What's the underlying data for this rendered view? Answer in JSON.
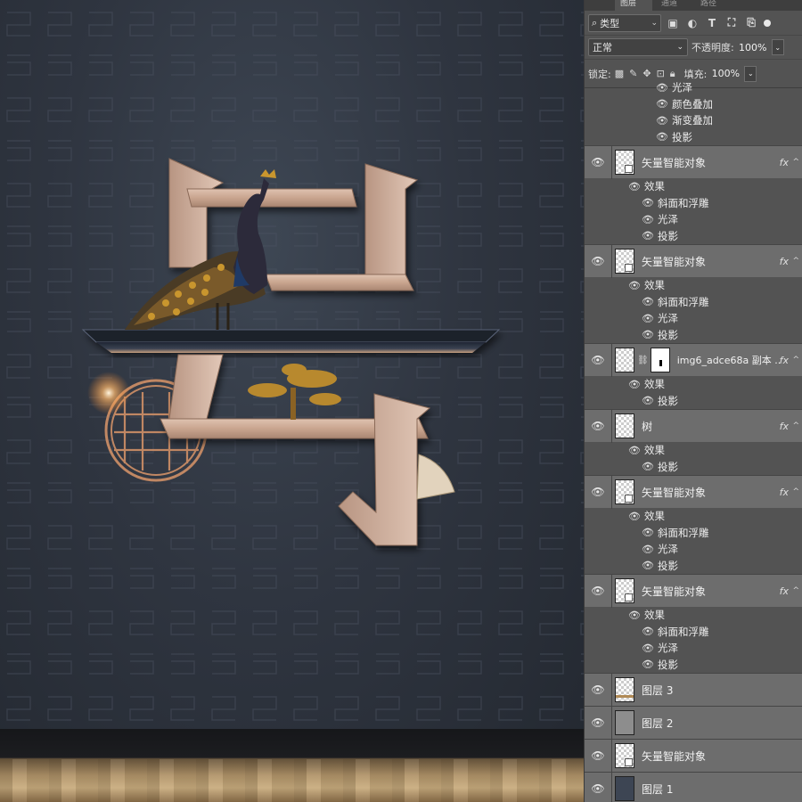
{
  "panel": {
    "tabs": [
      "图层",
      "通道",
      "路径"
    ],
    "filter": {
      "label": "类型",
      "icons": [
        "image-filter-icon",
        "adjustment-filter-icon",
        "type-filter-icon",
        "shape-filter-icon",
        "smart-object-filter-icon"
      ]
    },
    "blend_mode": "正常",
    "opacity_label": "不透明度:",
    "opacity_value": "100%",
    "lock_label": "锁定:",
    "lock_icons": [
      "lock-transparent-icon",
      "lock-paint-icon",
      "lock-position-icon",
      "lock-artboard-icon",
      "lock-all-icon"
    ],
    "fill_label": "填充:",
    "fill_value": "100%"
  },
  "layers": {
    "top_effects": [
      "光泽",
      "颜色叠加",
      "渐变叠加",
      "投影"
    ],
    "rows": [
      {
        "name": "矢量智能对象",
        "fx": "fx",
        "effects_label": "效果",
        "effects": [
          "斜面和浮雕",
          "光泽",
          "投影"
        ]
      },
      {
        "name": "矢量智能对象",
        "fx": "fx",
        "effects_label": "效果",
        "effects": [
          "斜面和浮雕",
          "光泽",
          "投影"
        ]
      },
      {
        "name": "img6_adce68a 副本 ...",
        "fx": "fx",
        "effects_label": "效果",
        "effects": [
          "投影"
        ]
      },
      {
        "name": "树",
        "fx": "fx",
        "effects_label": "效果",
        "effects": [
          "投影"
        ]
      },
      {
        "name": "矢量智能对象",
        "fx": "fx",
        "effects_label": "效果",
        "effects": [
          "斜面和浮雕",
          "光泽",
          "投影"
        ]
      },
      {
        "name": "矢量智能对象",
        "fx": "fx",
        "effects_label": "效果",
        "effects": [
          "斜面和浮雕",
          "光泽",
          "投影"
        ]
      },
      {
        "name": "图层 3"
      },
      {
        "name": "图层 2"
      },
      {
        "name": "矢量智能对象"
      },
      {
        "name": "图层 1"
      }
    ]
  },
  "colors": {
    "panel_bg": "#535353",
    "selected_row": "#6d6d6d",
    "letter_face": "#c9a58f",
    "canvas_bg": "#2f3540"
  }
}
